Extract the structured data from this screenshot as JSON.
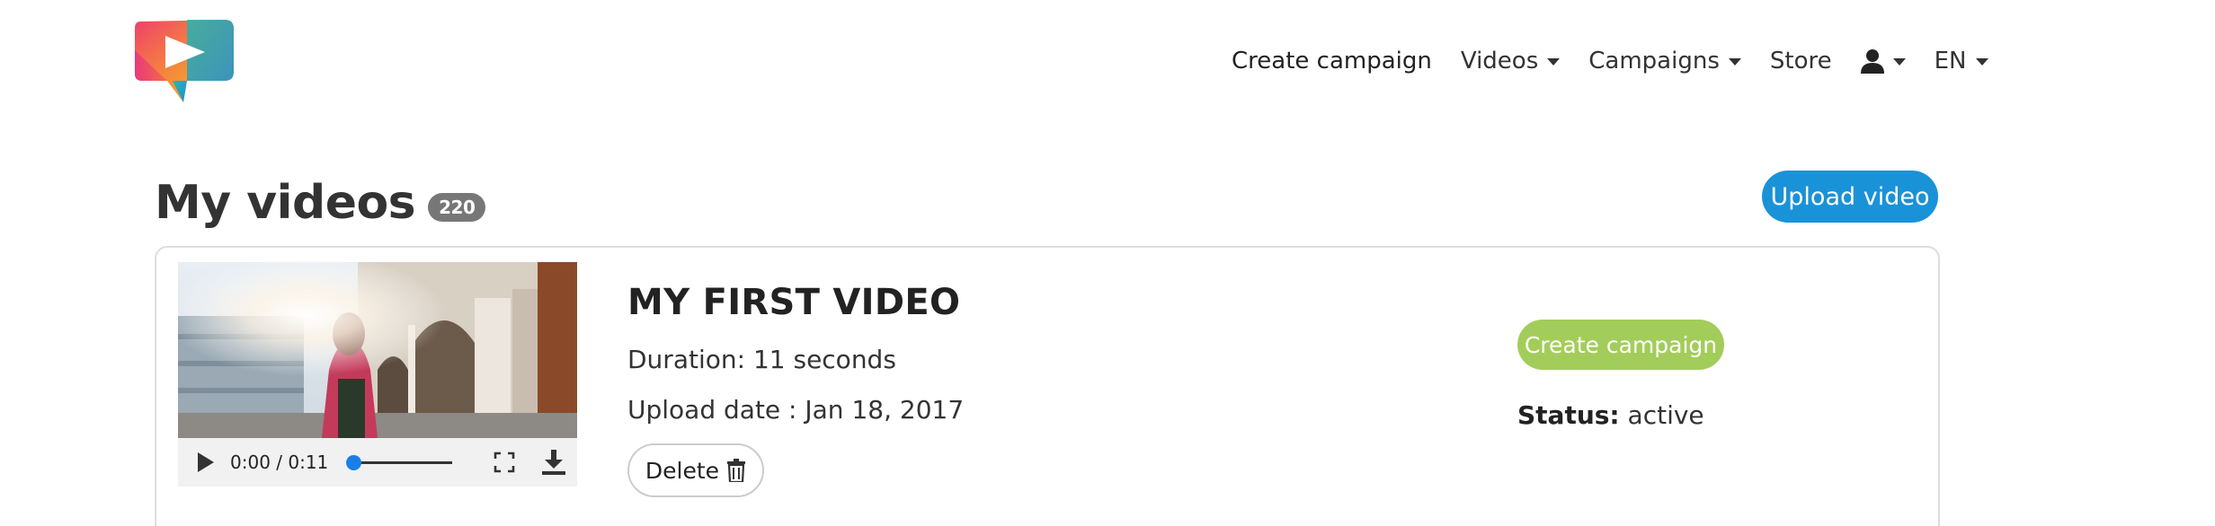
{
  "header": {
    "nav": {
      "create_campaign": "Create campaign",
      "videos": "Videos",
      "campaigns": "Campaigns",
      "store": "Store",
      "user_menu_icon": "user-icon",
      "language": "EN"
    }
  },
  "page": {
    "title": "My videos",
    "count": "220",
    "upload_label": "Upload video"
  },
  "video": {
    "title": "MY FIRST VIDEO",
    "duration": "Duration: 11 seconds",
    "upload_date": "Upload date : Jan 18, 2017",
    "delete_label": "Delete",
    "player": {
      "time": "0:00 / 0:11",
      "progress": 0
    },
    "create_campaign_label": "Create campaign",
    "status_label": "Status:",
    "status_value": "active"
  },
  "colors": {
    "primary": "#1a92d8",
    "campaign_green": "#a3cd5a",
    "badge_grey": "#777777"
  }
}
